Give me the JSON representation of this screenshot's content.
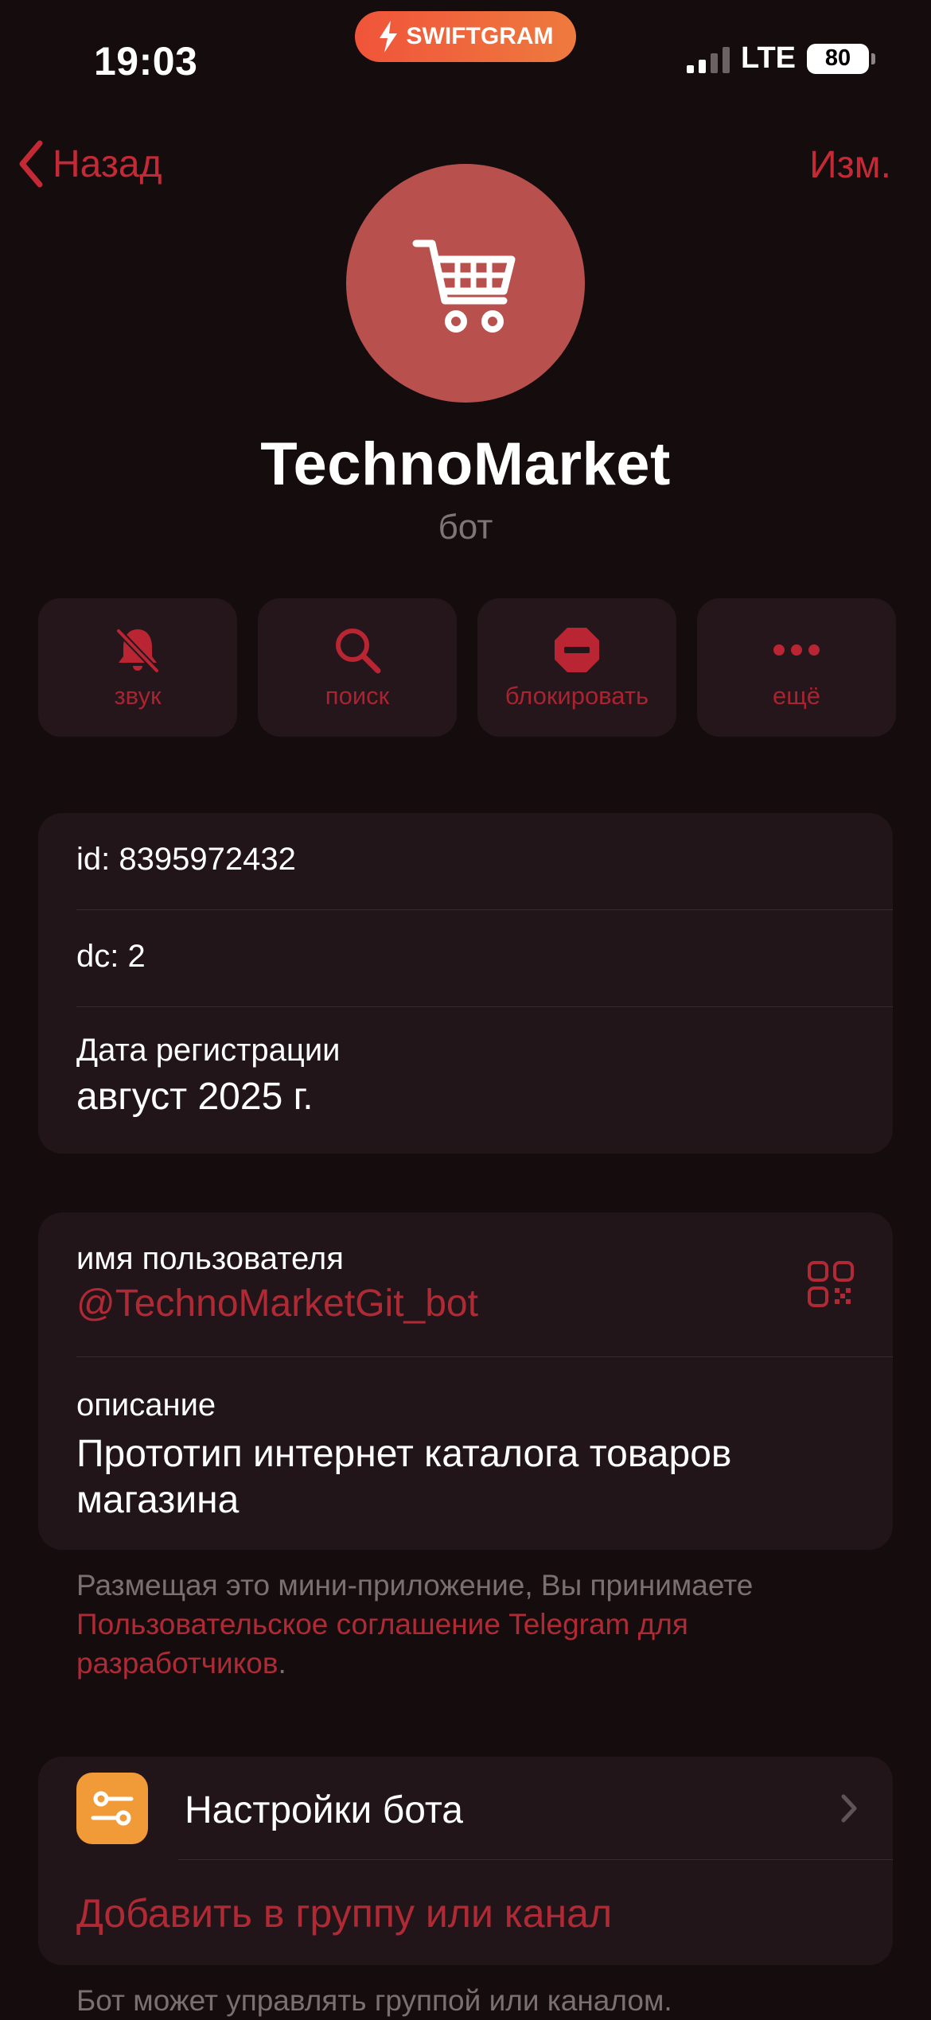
{
  "status": {
    "time": "19:03",
    "badge": "SWIFTGRAM",
    "network": "LTE",
    "battery": "80"
  },
  "nav": {
    "back_label": "Назад",
    "edit_label": "Изм."
  },
  "profile": {
    "name": "TechnoMarket",
    "type": "бот",
    "avatar_color": "#b8514d",
    "avatar_icon": "cart-icon"
  },
  "actions": [
    {
      "label": "звук",
      "icon": "bell-slash-icon"
    },
    {
      "label": "поиск",
      "icon": "search-icon"
    },
    {
      "label": "блокировать",
      "icon": "block-icon"
    },
    {
      "label": "ещё",
      "icon": "more-icon"
    }
  ],
  "info": {
    "id": "id: 8395972432",
    "dc": "dc: 2",
    "reg_label": "Дата регистрации",
    "reg_value": "август 2025 г."
  },
  "details": {
    "username_label": "имя пользователя",
    "username": "@TechnoMarketGit_bot",
    "description_label": "описание",
    "description": "Прототип интернет каталога товаров магазина"
  },
  "footnote": {
    "text_before": "Размещая это мини-приложение, Вы принимаете ",
    "link": "Пользовательское соглашение Telegram для разработчиков",
    "text_after": "."
  },
  "bot_section": {
    "settings_label": "Настройки бота",
    "add_label": "Добавить в группу или канал"
  },
  "bottom_note": "Бот может управлять группой или каналом.",
  "colors": {
    "accent": "#c42a35",
    "background": "#150c0e",
    "card": "#22151a",
    "settings_icon_bg": "#f19a38"
  }
}
